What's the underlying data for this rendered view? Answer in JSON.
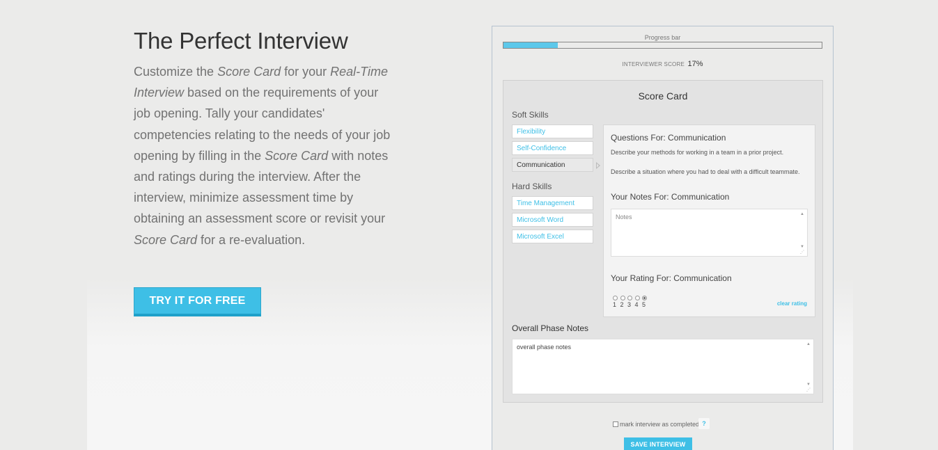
{
  "hero": {
    "title": "The Perfect Interview",
    "desc": {
      "p1": "Customize the ",
      "e1": "Score Card",
      "p2": " for your ",
      "e2": "Real-Time Interview",
      "p3": " based on the requirements of your job opening. Tally your candidates' competencies relating to the needs of your job opening by filling in the ",
      "e3": "Score Card",
      "p4": " with notes and ratings during the interview. After the interview, minimize assessment time by obtaining an assessment score or revisit your ",
      "e4": "Score Card",
      "p5": " for a re-evaluation."
    },
    "cta_label": "TRY IT FOR FREE"
  },
  "app": {
    "progress_label": "Progress bar",
    "progress_fraction": 0.17,
    "score_label": "INTERVIEWER SCORE",
    "score_value": "17%",
    "scorecard_title": "Score Card",
    "soft_skills_label": "Soft Skills",
    "soft_skills": [
      "Flexibility",
      "Self-Confidence",
      "Communication"
    ],
    "active_skill": "Communication",
    "hard_skills_label": "Hard Skills",
    "hard_skills": [
      "Time Management",
      "Microsoft Word",
      "Microsoft Excel"
    ],
    "questions_heading": "Questions For: Communication",
    "questions": [
      "Describe your methods for working in a team in a prior project.",
      "Describe a situation where you had to deal with a difficult teammate."
    ],
    "notes_heading": "Your Notes For: Communication",
    "notes_placeholder": "Notes",
    "rating_heading": "Your Rating For: Communication",
    "rating_options": [
      "1",
      "2",
      "3",
      "4",
      "5"
    ],
    "rating_selected": 5,
    "clear_rating": "clear rating",
    "overall_label": "Overall Phase Notes",
    "overall_value": "overall phase notes",
    "complete_label": "mark interview as completed",
    "help_label": "?",
    "save_label": "SAVE INTERVIEW"
  },
  "colors": {
    "accent": "#3ebfe6",
    "progress_fill": "#5dc8ea",
    "background": "#ebebea"
  }
}
